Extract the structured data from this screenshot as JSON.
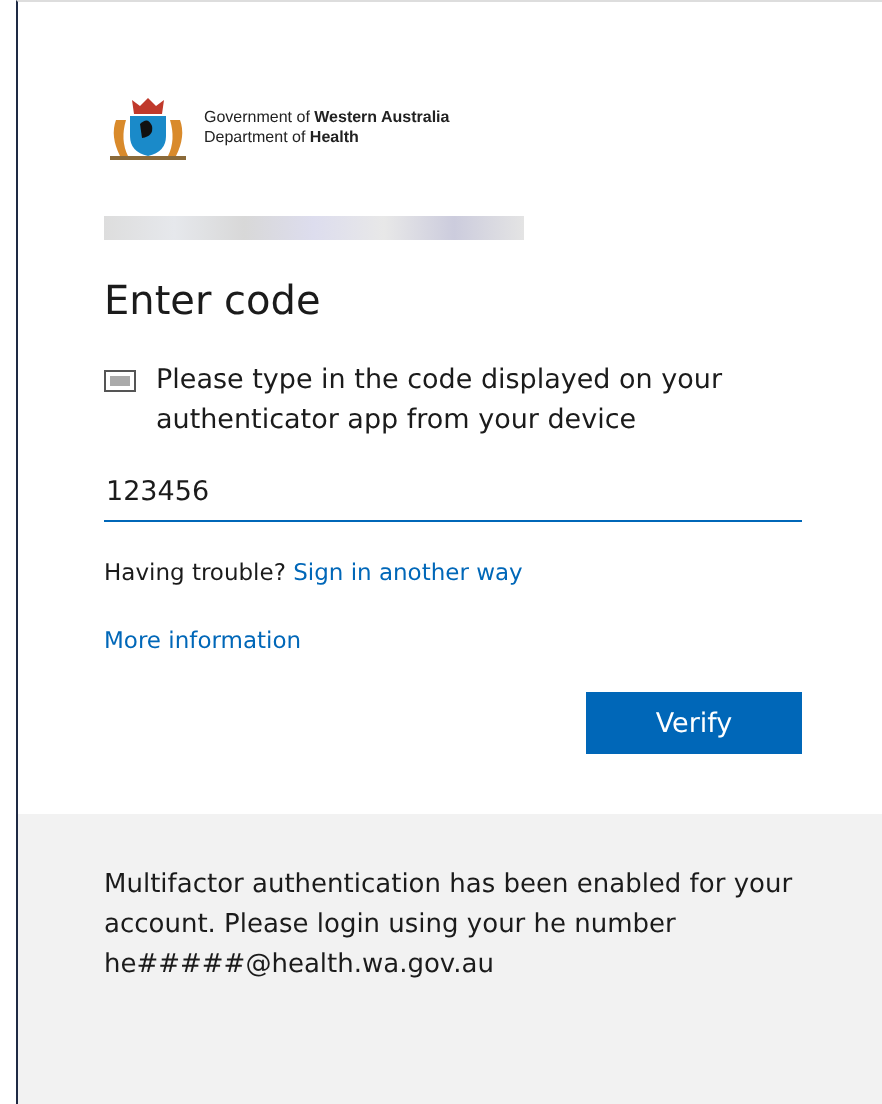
{
  "logo": {
    "line_1": "Government of **Western Australia**",
    "line_2": "Department of **Health**"
  },
  "heading": "Enter code",
  "instruction": "Please type in the code displayed on your authenticator app from your device",
  "code_field": {
    "value": "123456"
  },
  "trouble": {
    "text": "Having trouble?",
    "link": "Sign in another way"
  },
  "more_info": "More information",
  "verify_button": "Verify",
  "footer": {
    "lines": [
      "Multifactor authentication has been enabled for your",
      "account. Please login using your he number",
      "he#####@health.wa.gov.au"
    ]
  }
}
